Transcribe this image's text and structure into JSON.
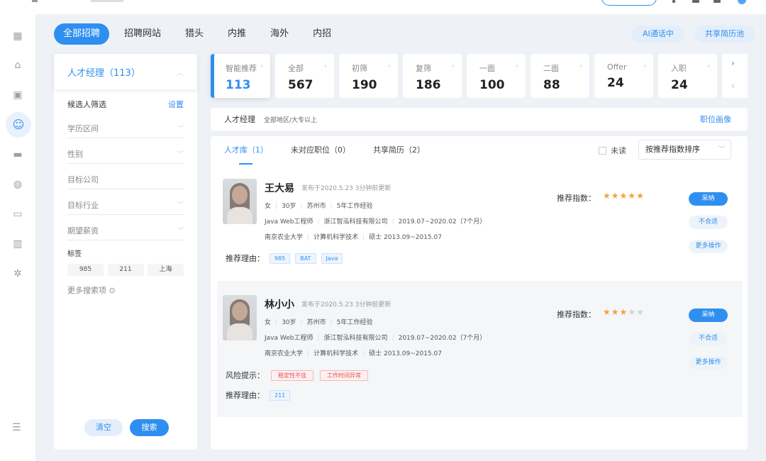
{
  "category_tabs": [
    "全部招聘",
    "招聘网站",
    "猎头",
    "内推",
    "海外",
    "内招"
  ],
  "top_actions": {
    "ai_call": "AI通话中",
    "share_pool": "共享简历池"
  },
  "filter": {
    "job_title": "人才经理（113）",
    "section_title": "候选人筛选",
    "settings": "设置",
    "fields": [
      "学历区间",
      "性别",
      "目标公司",
      "目标行业",
      "期望薪资"
    ],
    "tags_label": "标签",
    "tags": [
      "985",
      "211",
      "上海"
    ],
    "more_search": "更多搜索项 ⊙",
    "clear": "清空",
    "search": "搜索"
  },
  "stats": [
    {
      "label": "智能推荐",
      "value": "113"
    },
    {
      "label": "全部",
      "value": "567"
    },
    {
      "label": "初筛",
      "value": "190"
    },
    {
      "label": "复筛",
      "value": "186"
    },
    {
      "label": "一面",
      "value": "100"
    },
    {
      "label": "二面",
      "value": "88"
    },
    {
      "label": "Offer",
      "value": "24"
    },
    {
      "label": "入职",
      "value": "24"
    }
  ],
  "job_bar": {
    "name": "人才经理",
    "desc": "全部地区/大专以上",
    "portrait": "职位画像"
  },
  "sub_tabs": [
    "人才库（1）",
    "未对应职位（0）",
    "共享简历（2）"
  ],
  "unread": "未读",
  "sort": "按推荐指数排序",
  "candidates": [
    {
      "name": "王大易",
      "updated": "发布于2020.5.23 3分钟前更新",
      "gender": "女",
      "age": "30岁",
      "city": "苏州市",
      "exp": "5年工作经验",
      "position": "Java Web工程师",
      "company": "浙江智泓科技有限公司",
      "period": "2019.07~2020.02（7个月）",
      "school": "南京农业大学",
      "major": "计算机科学技术",
      "degree": "硕士 2013.09~2015.07",
      "score_label": "推荐指数：",
      "stars": 5,
      "risk_label": "",
      "risk_tags": [],
      "reason_label": "推荐理由：",
      "reason_tags": [
        "985",
        "BAT",
        "Java"
      ],
      "actions": [
        "采纳",
        "不合适",
        "更多操作"
      ]
    },
    {
      "name": "林小小",
      "updated": "发布于2020.5.23 3分钟前更新",
      "gender": "女",
      "age": "30岁",
      "city": "苏州市",
      "exp": "5年工作经验",
      "position": "Java Web工程师",
      "company": "浙江智泓科技有限公司",
      "period": "2019.07~2020.02（7个月）",
      "school": "南京农业大学",
      "major": "计算机科学技术",
      "degree": "硕士 2013.09~2015.07",
      "score_label": "推荐指数：",
      "stars": 3,
      "risk_label": "风险提示：",
      "risk_tags": [
        "稳定性不佳",
        "工作时间异常"
      ],
      "reason_label": "推荐理由：",
      "reason_tags": [
        "211"
      ],
      "actions": [
        "采纳",
        "不合适",
        "更多操作"
      ]
    }
  ],
  "icons": [
    "grid-icon",
    "home-icon",
    "briefcase-icon",
    "users-icon",
    "folder-icon",
    "globe-icon",
    "monitor-icon",
    "chart-icon",
    "settings-icon",
    "menu-collapse-icon"
  ],
  "accent": "#2f8ff0"
}
